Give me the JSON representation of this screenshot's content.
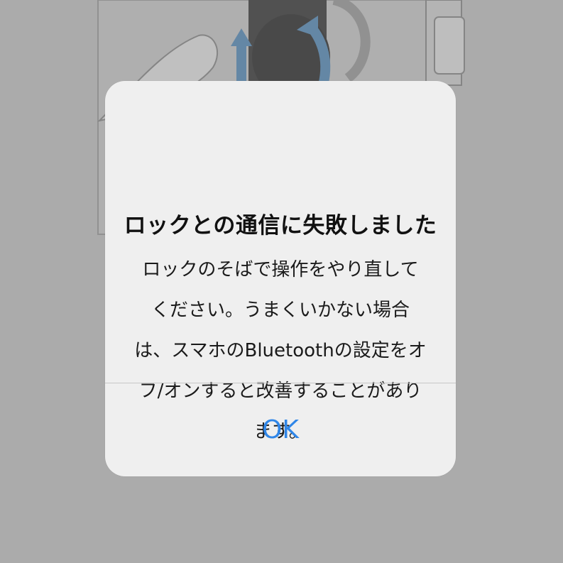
{
  "alert": {
    "title": "ロックとの通信に失敗しました",
    "message": "ロックのそばで操作をやり直してください。うまくいかない場合は、スマホのBluetoothの設定をオフ/オンすると改善することがあります。",
    "ok_label": "OK"
  },
  "colors": {
    "accent": "#2f86e8",
    "alert_background": "#efefef",
    "screen_background": "#bcbcbc"
  }
}
